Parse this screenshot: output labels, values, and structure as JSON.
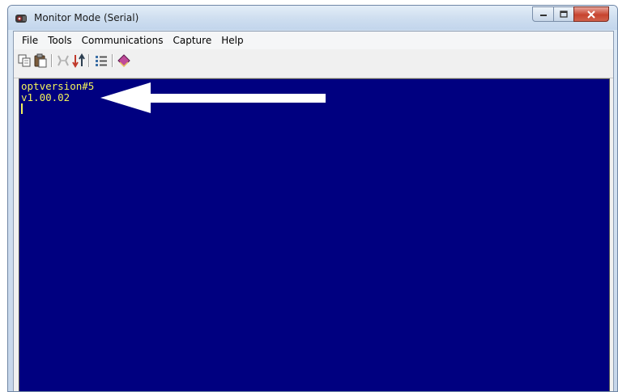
{
  "window": {
    "title": "Monitor Mode (Serial)",
    "icon": "app-icon"
  },
  "menu": {
    "items": [
      "File",
      "Tools",
      "Communications",
      "Capture",
      "Help"
    ]
  },
  "toolbar": {
    "buttons": [
      "copy-icon",
      "paste-icon",
      "disconnect-icon",
      "connect-icon",
      "settings-list-icon",
      "book-icon"
    ]
  },
  "terminal": {
    "lines": [
      "optversion#5",
      "v1.00.02"
    ],
    "background": "#000080",
    "text_color": "#f2f25a"
  },
  "annotation": {
    "arrow_color": "#ffffff",
    "points_to_line": 2
  }
}
